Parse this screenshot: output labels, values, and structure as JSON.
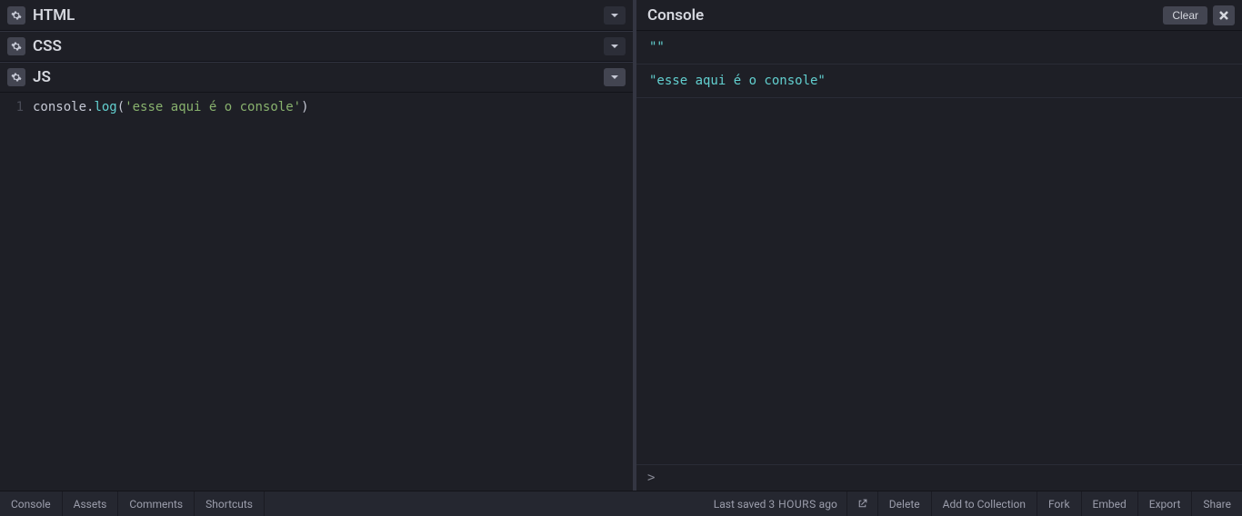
{
  "panels": {
    "html": {
      "title": "HTML"
    },
    "css": {
      "title": "CSS"
    },
    "js": {
      "title": "JS",
      "lineNumber": "1",
      "code": {
        "ident": "console",
        "dot": ".",
        "method": "log",
        "open": "(",
        "string": "'esse aqui é o console'",
        "close": ")"
      }
    }
  },
  "console": {
    "title": "Console",
    "clearLabel": "Clear",
    "rows": [
      "\"\"",
      "\"esse aqui é o console\""
    ],
    "prompt": ">"
  },
  "footer": {
    "left": [
      "Console",
      "Assets",
      "Comments",
      "Shortcuts"
    ],
    "savedPrefix": "Last saved ",
    "savedTime": "3 HOURS",
    "savedSuffix": " ago",
    "right": [
      "Delete",
      "Add to Collection",
      "Fork",
      "Embed",
      "Export",
      "Share"
    ]
  }
}
